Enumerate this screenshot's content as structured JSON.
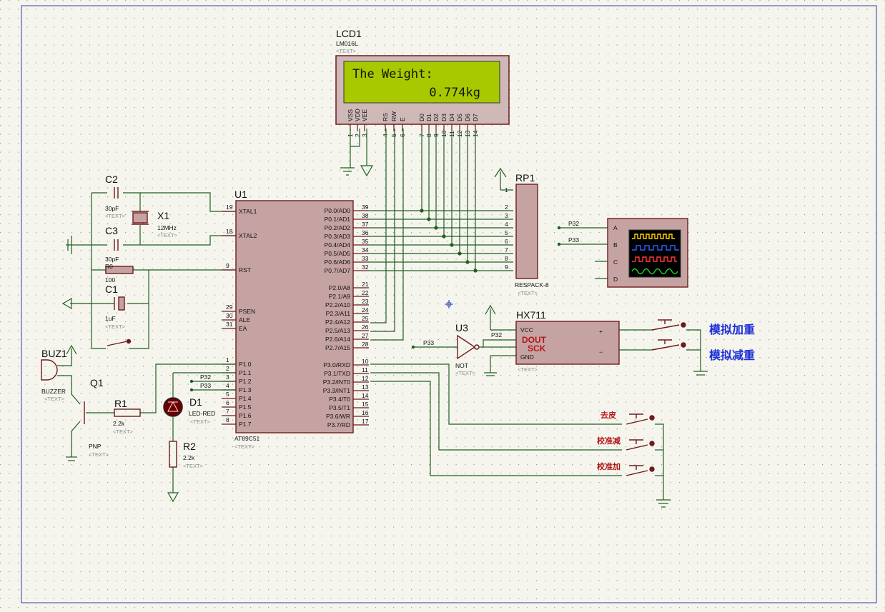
{
  "lcd": {
    "ref": "LCD1",
    "model": "LM016L",
    "text_tag": "<TEXT>",
    "line1": "The Weight:",
    "line2": "0.774kg",
    "pins": [
      "VSS",
      "VDD",
      "VEE",
      "RS",
      "RW",
      "E",
      "D0",
      "D1",
      "D2",
      "D3",
      "D4",
      "D5",
      "D6",
      "D7"
    ],
    "pin_numbers": [
      "1",
      "2",
      "3",
      "4",
      "5",
      "6",
      "7",
      "8",
      "9",
      "10",
      "11",
      "12",
      "13",
      "14"
    ]
  },
  "mcu": {
    "ref": "U1",
    "model": "AT89C51",
    "text_tag": "<TEXT>",
    "left_pins": [
      {
        "no": "19",
        "name": "XTAL1"
      },
      {
        "no": "18",
        "name": "XTAL2"
      },
      {
        "no": "9",
        "name": "RST"
      },
      {
        "no": "29",
        "name": "PSEN"
      },
      {
        "no": "30",
        "name": "ALE"
      },
      {
        "no": "31",
        "name": "EA"
      },
      {
        "no": "1",
        "name": "P1.0"
      },
      {
        "no": "2",
        "name": "P1.1"
      },
      {
        "no": "3",
        "name": "P1.2"
      },
      {
        "no": "4",
        "name": "P1.3"
      },
      {
        "no": "5",
        "name": "P1.4"
      },
      {
        "no": "6",
        "name": "P1.5"
      },
      {
        "no": "7",
        "name": "P1.6"
      },
      {
        "no": "8",
        "name": "P1.7"
      }
    ],
    "right_pins": [
      {
        "no": "39",
        "name": "P0.0/AD0"
      },
      {
        "no": "38",
        "name": "P0.1/AD1"
      },
      {
        "no": "37",
        "name": "P0.2/AD2"
      },
      {
        "no": "36",
        "name": "P0.3/AD3"
      },
      {
        "no": "35",
        "name": "P0.4/AD4"
      },
      {
        "no": "34",
        "name": "P0.5/AD5"
      },
      {
        "no": "33",
        "name": "P0.6/AD6"
      },
      {
        "no": "32",
        "name": "P0.7/AD7"
      },
      {
        "no": "21",
        "name": "P2.0/A8"
      },
      {
        "no": "22",
        "name": "P2.1/A9"
      },
      {
        "no": "23",
        "name": "P2.2/A10"
      },
      {
        "no": "24",
        "name": "P2.3/A11"
      },
      {
        "no": "25",
        "name": "P2.4/A12"
      },
      {
        "no": "26",
        "name": "P2.5/A13"
      },
      {
        "no": "27",
        "name": "P2.6/A14"
      },
      {
        "no": "28",
        "name": "P2.7/A15"
      },
      {
        "no": "10",
        "name": "P3.0/RXD"
      },
      {
        "no": "11",
        "name": "P3.1/TXD"
      },
      {
        "no": "12",
        "name": "P3.2/INT0"
      },
      {
        "no": "13",
        "name": "P3.3/INT1"
      },
      {
        "no": "14",
        "name": "P3.4/T0"
      },
      {
        "no": "15",
        "name": "P3.5/T1"
      },
      {
        "no": "16",
        "name": "P3.6/WR"
      },
      {
        "no": "17",
        "name": "P3.7/RD"
      }
    ]
  },
  "rp1": {
    "ref": "RP1",
    "model": "RESPACK-8",
    "text_tag": "<TEXT>",
    "pins": [
      "1",
      "2",
      "3",
      "4",
      "5",
      "6",
      "7",
      "8",
      "9"
    ]
  },
  "scope": {
    "channels": [
      "A",
      "B",
      "C",
      "D"
    ],
    "net_a": "P32",
    "net_b": "P33"
  },
  "hx711": {
    "ref": "HX711",
    "pins": [
      "VCC",
      "DOUT",
      "SCK",
      "GND"
    ],
    "plus": "+",
    "minus": "−",
    "text_tag": "<TEXT>",
    "net": "P32"
  },
  "not_gate": {
    "ref": "U3",
    "model": "NOT",
    "text_tag": "<TEXT>",
    "net": "P33"
  },
  "c2": {
    "ref": "C2",
    "value": "30pF",
    "text_tag": "<TEXT>"
  },
  "c3": {
    "ref": "C3",
    "value": "30pF",
    "text_tag": "<TEXT>"
  },
  "x1": {
    "ref": "X1",
    "value": "12MHz",
    "text_tag": "<TEXT>"
  },
  "r0": {
    "ref": "R0",
    "value": "100"
  },
  "c1": {
    "ref": "C1",
    "value": "1uF",
    "text_tag": "<TEXT>"
  },
  "buzzer": {
    "ref": "BUZ1",
    "model": "BUZZER",
    "text_tag": "<TEXT>"
  },
  "q1": {
    "ref": "Q1",
    "model": "PNP",
    "text_tag": "<TEXT>"
  },
  "r1": {
    "ref": "R1",
    "value": "2.2k",
    "text_tag": "<TEXT>"
  },
  "d1": {
    "ref": "D1",
    "model": "LED-RED",
    "text_tag": "<TEXT>"
  },
  "r2": {
    "ref": "R2",
    "value": "2.2k",
    "text_tag": "<TEXT>"
  },
  "p1_nets": {
    "p12": "P32",
    "p13": "P33"
  },
  "buttons": {
    "add_weight": "模拟加重",
    "sub_weight": "模拟减重",
    "tare": "去皮",
    "cal_minus": "校准减",
    "cal_plus": "校准加"
  },
  "colors": {
    "wire": "#1f5f1f",
    "part": "#6e1b1b",
    "lcd_screen": "#a8c800",
    "blue_label": "#1d2fd6",
    "red_label": "#b01818",
    "grid_dot": "#a0a0a0"
  }
}
